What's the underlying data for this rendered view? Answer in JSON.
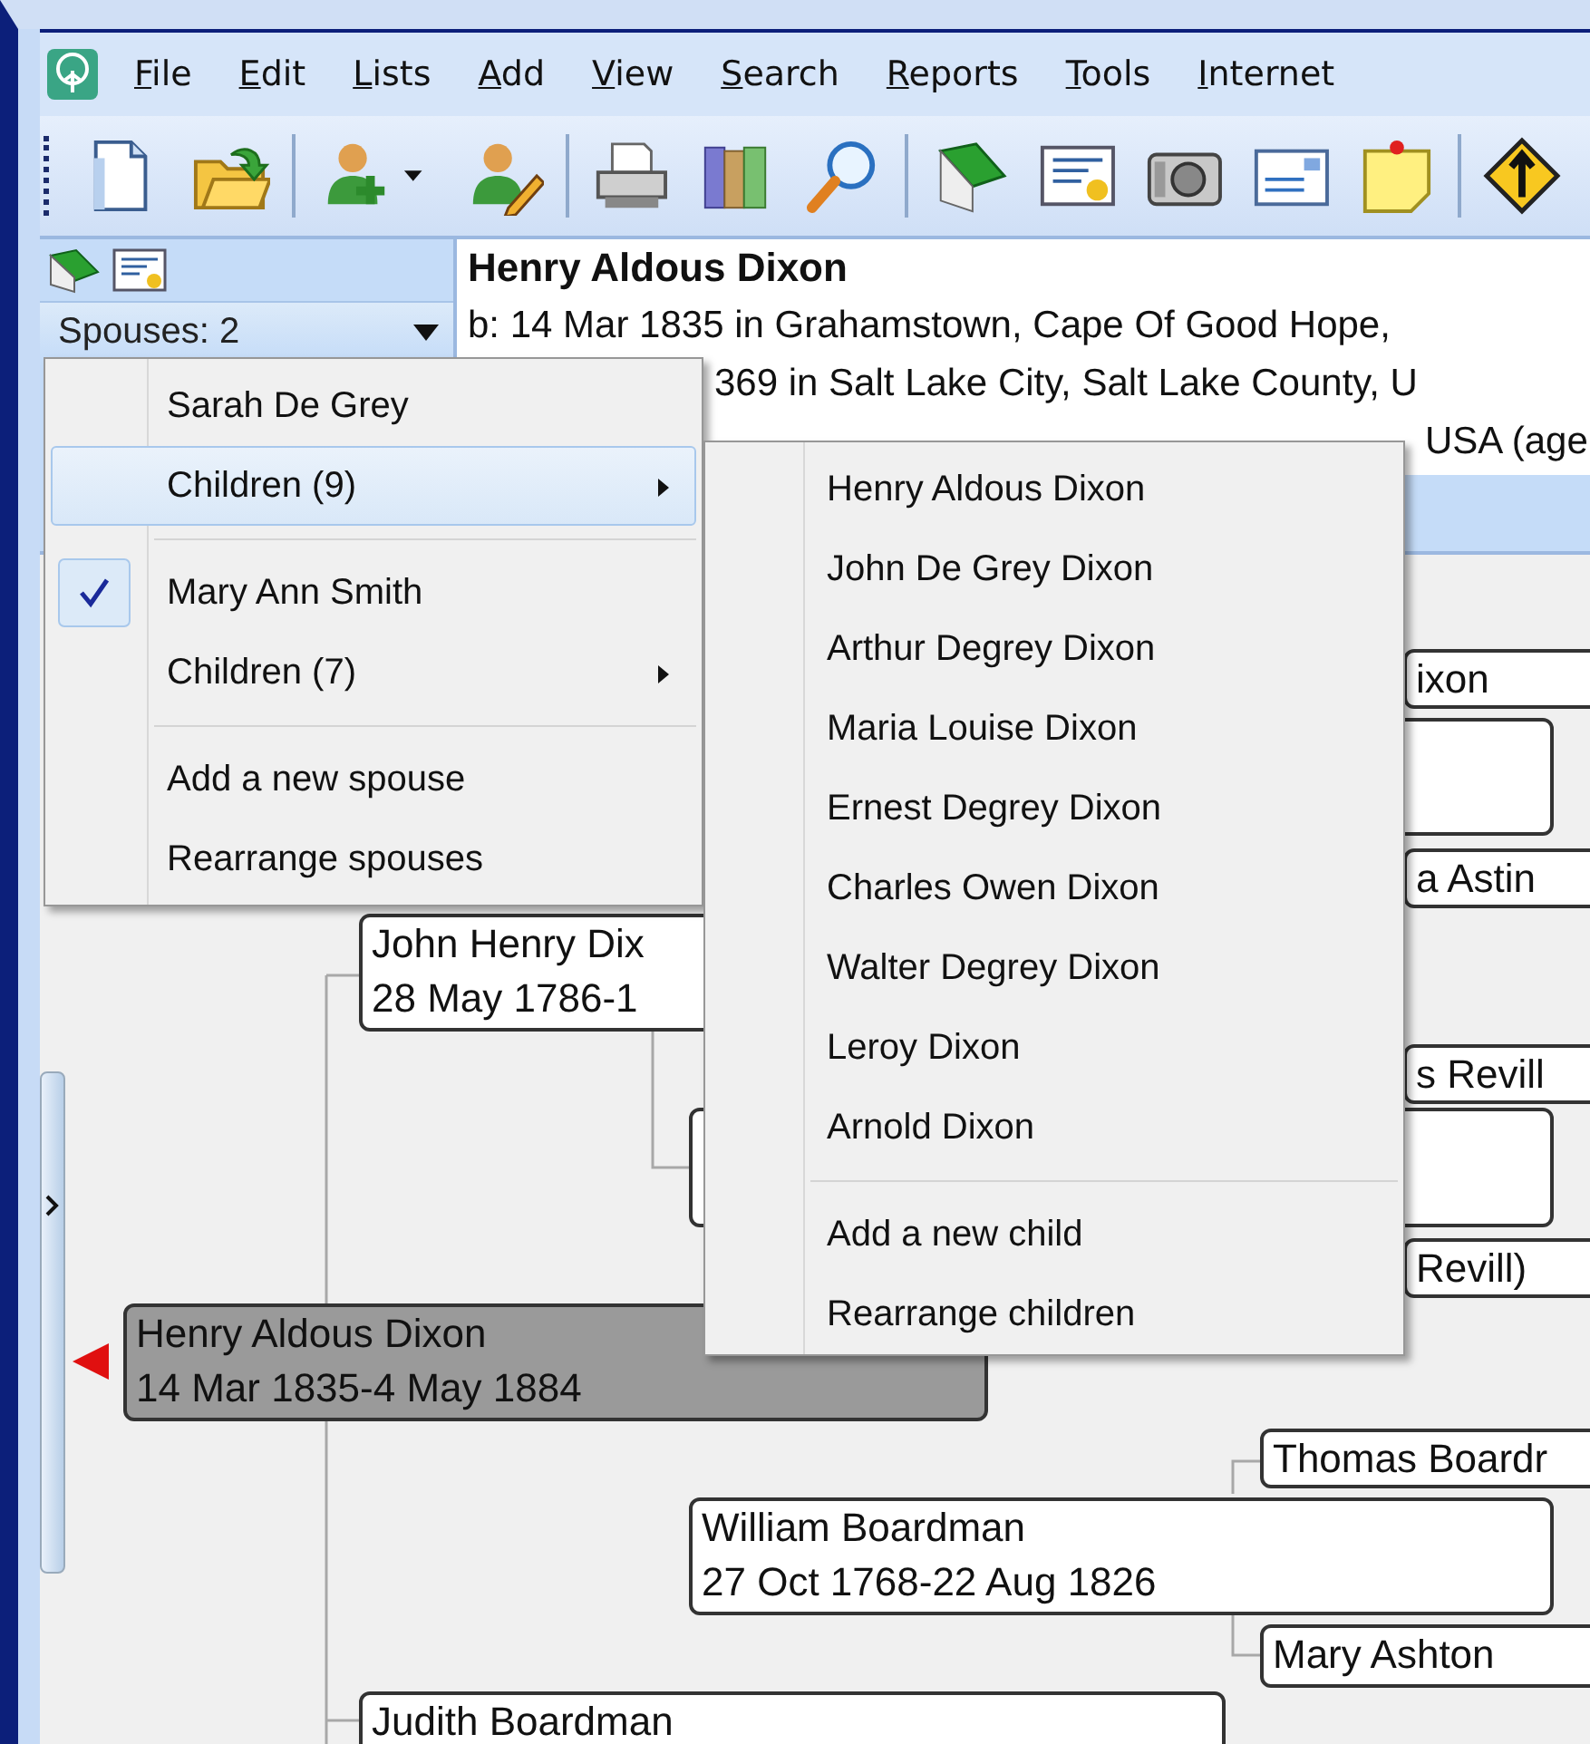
{
  "menu_bar": [
    {
      "label": "File"
    },
    {
      "label": "Edit"
    },
    {
      "label": "Lists"
    },
    {
      "label": "Add"
    },
    {
      "label": "View"
    },
    {
      "label": "Search"
    },
    {
      "label": "Reports"
    },
    {
      "label": "Tools"
    },
    {
      "label": "Internet"
    }
  ],
  "person_panel": {
    "spouses_dropdown": "Spouses: 2",
    "name": "Henry Aldous Dixon",
    "details": [
      {
        "kind": "full",
        "text": "b: 14 Mar 1835 in Grahamstown, Cape Of Good Hope,"
      },
      {
        "kind": "behind_menu",
        "text": "369 in Salt Lake City, Salt Lake County, U"
      },
      {
        "kind": "behind_submenu",
        "text": "USA (age"
      }
    ]
  },
  "tree": {
    "nodes": [
      {
        "lines": [
          "ixon"
        ],
        "selected": false
      },
      {
        "selected": false
      },
      {
        "lines": [
          "a Astin"
        ],
        "selected": false
      },
      {
        "lines": [
          "John Henry Dix",
          "28 May 1786-1"
        ],
        "selected": false
      },
      {
        "selected": false
      },
      {
        "lines": [
          "s Revill"
        ],
        "selected": false
      },
      {
        "lines": [
          "Revill)"
        ],
        "selected": false
      },
      {
        "lines": [
          "Henry Aldous Dixon",
          "14 Mar 1835-4 May 1884"
        ],
        "selected": true
      },
      {
        "lines": [
          "Thomas Boardr"
        ],
        "selected": false
      },
      {
        "lines": [
          "William Boardman",
          "27 Oct 1768-22 Aug 1826"
        ],
        "selected": false
      },
      {
        "lines": [
          "Mary Ashton"
        ],
        "selected": false
      },
      {
        "lines": [
          "Judith Boardman"
        ],
        "selected": false
      }
    ]
  },
  "spouse_menu": {
    "items": [
      {
        "kind": "item",
        "label": "Sarah De Grey",
        "checked": false,
        "selected": false
      },
      {
        "kind": "submenu",
        "label": "Children (9)",
        "checked": false,
        "selected": true
      },
      {
        "kind": "separator"
      },
      {
        "kind": "item",
        "label": "Mary Ann Smith",
        "checked": true,
        "selected": false
      },
      {
        "kind": "submenu",
        "label": "Children (7)",
        "checked": false,
        "selected": false
      },
      {
        "kind": "separator"
      },
      {
        "kind": "item",
        "label": "Add a new spouse",
        "checked": false,
        "selected": false
      },
      {
        "kind": "item",
        "label": "Rearrange spouses",
        "checked": false,
        "selected": false
      }
    ]
  },
  "children_menu": {
    "items": [
      {
        "kind": "item",
        "label": "Henry Aldous Dixon"
      },
      {
        "kind": "item",
        "label": "John De Grey Dixon"
      },
      {
        "kind": "item",
        "label": "Arthur Degrey Dixon"
      },
      {
        "kind": "item",
        "label": "Maria Louise Dixon"
      },
      {
        "kind": "item",
        "label": "Ernest Degrey Dixon"
      },
      {
        "kind": "item",
        "label": "Charles Owen Dixon"
      },
      {
        "kind": "item",
        "label": "Walter Degrey Dixon"
      },
      {
        "kind": "item",
        "label": "Leroy Dixon"
      },
      {
        "kind": "item",
        "label": "Arnold Dixon"
      },
      {
        "kind": "separator"
      },
      {
        "kind": "item",
        "label": "Add a new child"
      },
      {
        "kind": "item",
        "label": "Rearrange children"
      }
    ]
  }
}
